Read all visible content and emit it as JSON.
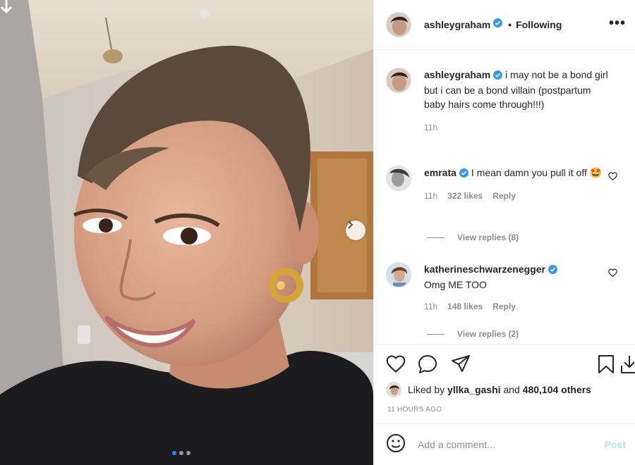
{
  "post": {
    "author": "ashleygraham",
    "follow_separator": "•",
    "follow_status": "Following",
    "more_icon": "more-options-icon",
    "caption": "i may not be a bond girl but i can be a bond villain (postpartum baby hairs come through!!!)",
    "caption_time": "11h",
    "carousel_slide": 1,
    "carousel_total": 3
  },
  "comments": [
    {
      "username": "emrata",
      "text": "I mean damn you pull it off 🤩",
      "time": "11h",
      "likes": "322 likes",
      "reply_label": "Reply",
      "view_replies": "View replies (8)"
    },
    {
      "username": "katherineschwarzenegger",
      "text": "Omg ME TOO",
      "time": "11h",
      "likes": "148 likes",
      "reply_label": "Reply",
      "view_replies": "View replies (2)"
    }
  ],
  "likes_summary": {
    "prefix": "Liked by",
    "liker": "yllka_gashi",
    "joiner": "and",
    "others": "480,104 others"
  },
  "timestamp": "11 HOURS AGO",
  "add_comment": {
    "placeholder": "Add a comment...",
    "post_label": "Post"
  },
  "colors": {
    "verified": "#3897f0",
    "link_muted": "#8e8e8e",
    "post_disabled": "#b2dffc",
    "carousel_active": "#1a8cff"
  }
}
